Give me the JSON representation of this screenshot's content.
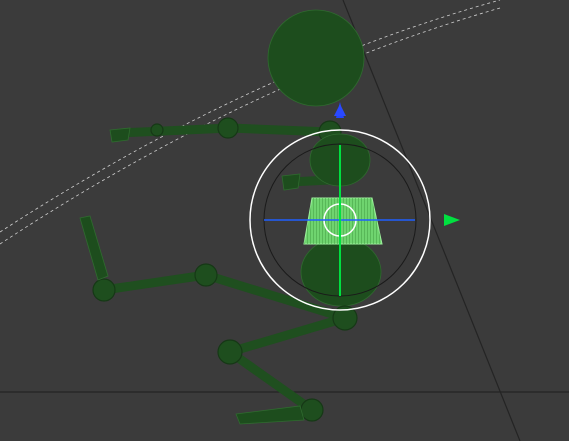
{
  "viewport": {
    "view": "perspective",
    "background_color": "#3b3b3b",
    "wireframe_color": "#1f4f1f",
    "selected_color": "#6fd46f"
  },
  "character": {
    "selected_part": "spine",
    "parts": [
      "head",
      "neck",
      "chest",
      "spine",
      "pelvis",
      "left-arm",
      "right-arm",
      "left-leg",
      "right-leg",
      "left-foot",
      "right-foot"
    ]
  },
  "manipulator": {
    "tool": "transform",
    "axes": [
      {
        "name": "x",
        "color": "#1f5fff",
        "icon": "x-axis-line"
      },
      {
        "name": "y",
        "color": "#00ff44",
        "icon": "y-axis-arrow"
      },
      {
        "name": "z",
        "color": "#2244ff",
        "icon": "z-axis-arrow"
      }
    ],
    "ring_color": "#ffffff"
  }
}
